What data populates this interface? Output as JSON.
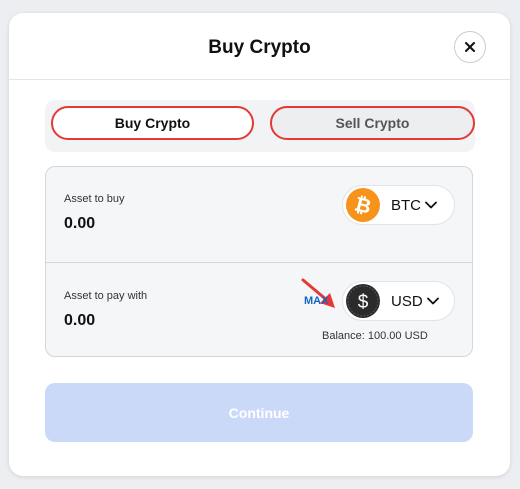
{
  "modal": {
    "title": "Buy Crypto"
  },
  "tabs": [
    {
      "label": "Buy Crypto",
      "active": true
    },
    {
      "label": "Sell Crypto",
      "active": false
    }
  ],
  "buy_section": {
    "label": "Asset to buy",
    "amount": "0.00",
    "asset": {
      "symbol": "BTC",
      "icon": "bitcoin-icon",
      "color": "#f7931a"
    }
  },
  "pay_section": {
    "label": "Asset to pay with",
    "amount": "0.00",
    "max_label": "MAX",
    "asset": {
      "symbol": "USD",
      "icon": "dollar-icon",
      "color": "#2b2b2b"
    },
    "balance": "Balance: 100.00 USD"
  },
  "continue_button": {
    "label": "Continue",
    "enabled": false
  },
  "colors": {
    "highlight": "#e53935",
    "link": "#1565c0",
    "disabled_button": "#c9d9f7"
  }
}
